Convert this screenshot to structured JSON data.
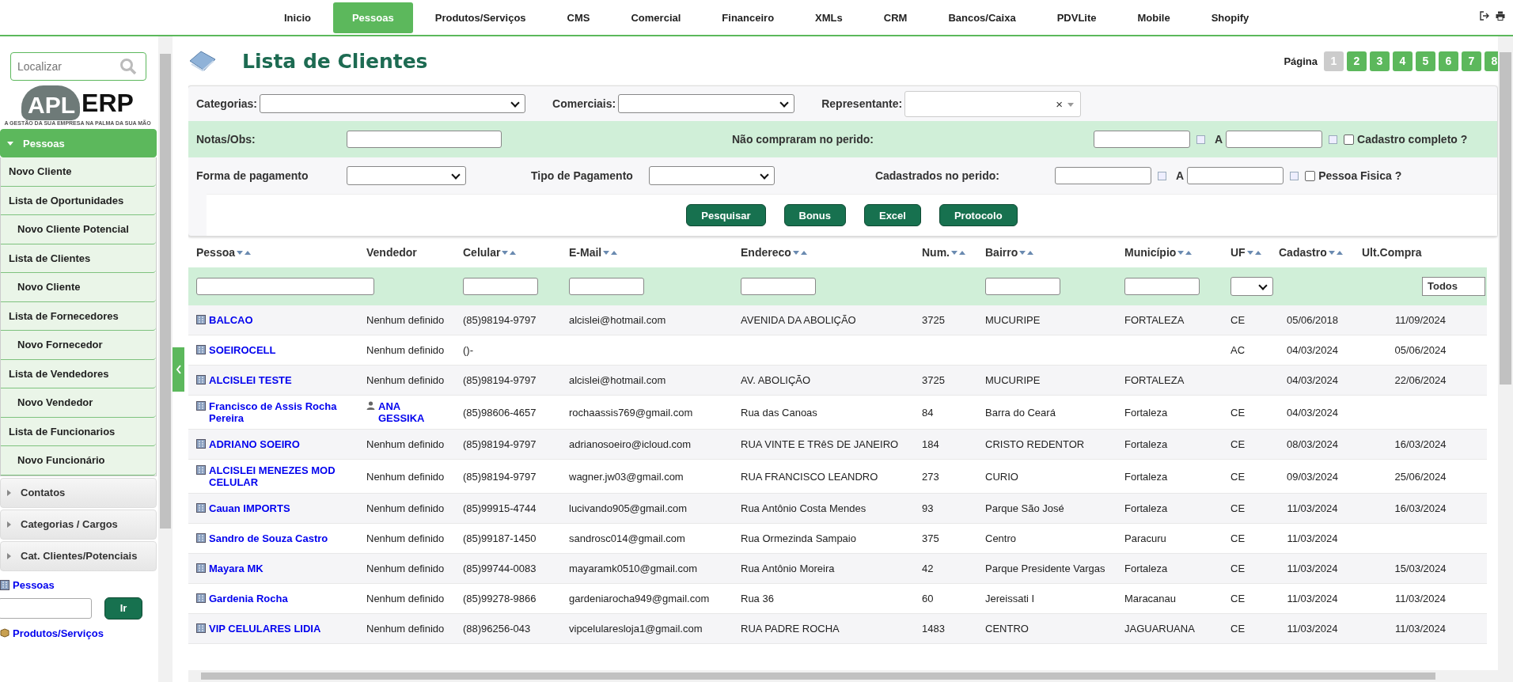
{
  "nav": {
    "items": [
      {
        "label": "Inicio",
        "selected": false
      },
      {
        "label": "Pessoas",
        "selected": true
      },
      {
        "label": "Produtos/Serviços",
        "selected": false
      },
      {
        "label": "CMS",
        "selected": false
      },
      {
        "label": "Comercial",
        "selected": false
      },
      {
        "label": "Financeiro",
        "selected": false
      },
      {
        "label": "XMLs",
        "selected": false
      },
      {
        "label": "CRM",
        "selected": false
      },
      {
        "label": "Bancos/Caixa",
        "selected": false
      },
      {
        "label": "PDVLite",
        "selected": false
      },
      {
        "label": "Mobile",
        "selected": false
      },
      {
        "label": "Shopify",
        "selected": false
      }
    ]
  },
  "sidebar": {
    "search_placeholder": "Localizar",
    "logo": {
      "left": "APL",
      "right": "ERP",
      "tagline": "A GESTÃO DA SUA EMPRESA NA PALMA DA SUA MÃO"
    },
    "sections": [
      {
        "label": "Pessoas",
        "expanded": true,
        "items": [
          {
            "label": "Novo Cliente"
          },
          {
            "label": "Lista de Oportunidades",
            "children": [
              {
                "label": "Novo Cliente Potencial"
              }
            ]
          },
          {
            "label": "Lista de Clientes",
            "children": [
              {
                "label": "Novo Cliente"
              }
            ]
          },
          {
            "label": "Lista de Fornecedores",
            "children": [
              {
                "label": "Novo Fornecedor"
              }
            ]
          },
          {
            "label": "Lista de Vendedores",
            "children": [
              {
                "label": "Novo Vendedor"
              }
            ]
          },
          {
            "label": "Lista de Funcionarios",
            "children": [
              {
                "label": "Novo Funcionário"
              }
            ]
          }
        ]
      },
      {
        "label": "Contatos",
        "expanded": false
      },
      {
        "label": "Categorias / Cargos",
        "expanded": false
      },
      {
        "label": "Cat. Clientes/Potenciais",
        "expanded": false
      }
    ],
    "quick_link": "Pessoas",
    "go_button": "Ir",
    "bottom_link": "Produtos/Serviços"
  },
  "page": {
    "title": "Lista de Clientes",
    "pagination_label": "Página",
    "pages": [
      {
        "label": "1",
        "selected": true
      },
      {
        "label": "2",
        "selected": false
      },
      {
        "label": "3",
        "selected": false
      },
      {
        "label": "4",
        "selected": false
      },
      {
        "label": "5",
        "selected": false
      },
      {
        "label": "6",
        "selected": false
      },
      {
        "label": "7",
        "selected": false
      },
      {
        "label": "8",
        "selected": false
      }
    ]
  },
  "filters": {
    "categorias": "Categorias:",
    "comerciais": "Comerciais:",
    "representante": "Representante:",
    "clear": "×",
    "notas": "Notas/Obs:",
    "nao_compraram": "Não compraram no perido:",
    "range_sep_1": "A",
    "cadastro_completo": {
      "label": "Cadastro completo ?",
      "checked": false
    },
    "forma_pagamento": "Forma de pagamento",
    "tipo_pagamento": "Tipo de Pagamento",
    "cadastrados": "Cadastrados no perido:",
    "range_sep_2": "A",
    "pessoa_fisica": {
      "label": "Pessoa Fisica ?",
      "checked": false
    },
    "buttons": [
      "Pesquisar",
      "Bonus",
      "Excel",
      "Protocolo"
    ]
  },
  "table": {
    "columns": [
      {
        "label": "Pessoa",
        "sortable": true,
        "kind": "text"
      },
      {
        "label": "Vendedor",
        "sortable": false,
        "kind": "none"
      },
      {
        "label": "Celular",
        "sortable": true,
        "kind": "text"
      },
      {
        "label": "E-Mail",
        "sortable": true,
        "kind": "text"
      },
      {
        "label": "Endereco",
        "sortable": true,
        "kind": "text"
      },
      {
        "label": "Num.",
        "sortable": true,
        "kind": "none"
      },
      {
        "label": "Bairro",
        "sortable": true,
        "kind": "text"
      },
      {
        "label": "Município",
        "sortable": true,
        "kind": "text"
      },
      {
        "label": "UF",
        "sortable": true,
        "kind": "select"
      },
      {
        "label": "Cadastro",
        "sortable": true,
        "kind": "none"
      },
      {
        "label": "Ult.Compra",
        "sortable": false,
        "kind": "none"
      }
    ],
    "status_filter": "Todos",
    "rows": [
      {
        "name": "BALCAO",
        "seller": {
          "kind": "plain",
          "name": "Nenhum definido"
        },
        "phone": "(85)98194-9797",
        "email": "alcislei@hotmail.com",
        "address": "AVENIDA DA ABOLIÇÃO",
        "number": "3725",
        "district": "MUCURIPE",
        "city": "FORTALEZA",
        "uf": "CE",
        "created": "05/06/2018",
        "last_purchase": "11/09/2024"
      },
      {
        "name": "SOEIROCELL",
        "seller": {
          "kind": "plain",
          "name": "Nenhum definido"
        },
        "phone": "()-",
        "uf": "AC",
        "created": "04/03/2024",
        "last_purchase": "05/06/2024"
      },
      {
        "name": "ALCISLEI TESTE",
        "seller": {
          "kind": "plain",
          "name": "Nenhum definido"
        },
        "phone": "(85)98194-9797",
        "email": "alcislei@hotmail.com",
        "address": "AV. ABOLIÇÃO",
        "number": "3725",
        "district": "MUCURIPE",
        "city": "FORTALEZA",
        "created": "04/03/2024",
        "last_purchase": "22/06/2024"
      },
      {
        "name": "Francisco de Assis Rocha Pereira",
        "seller": {
          "kind": "user",
          "name": "ANA GESSIKA"
        },
        "phone": "(85)98606-4657",
        "email": "rochaassis769@gmail.com",
        "address": "Rua das Canoas",
        "number": "84",
        "district": "Barra do Ceará",
        "city": "Fortaleza",
        "uf": "CE",
        "created": "04/03/2024"
      },
      {
        "name": "ADRIANO SOEIRO",
        "seller": {
          "kind": "plain",
          "name": "Nenhum definido"
        },
        "phone": "(85)98194-9797",
        "email": "adrianosoeiro@icloud.com",
        "address": "RUA VINTE E TRêS DE JANEIRO",
        "number": "184",
        "district": "CRISTO REDENTOR",
        "city": "Fortaleza",
        "uf": "CE",
        "created": "08/03/2024",
        "last_purchase": "16/03/2024"
      },
      {
        "name": "ALCISLEI MENEZES MOD CELULAR",
        "seller": {
          "kind": "plain",
          "name": "Nenhum definido"
        },
        "phone": "(85)98194-9797",
        "email": "wagner.jw03@gmail.com",
        "address": "RUA FRANCISCO LEANDRO",
        "number": "273",
        "district": "CURIO",
        "city": "Fortaleza",
        "uf": "CE",
        "created": "09/03/2024",
        "last_purchase": "25/06/2024"
      },
      {
        "name": "Cauan IMPORTS",
        "seller": {
          "kind": "plain",
          "name": "Nenhum definido"
        },
        "phone": "(85)99915-4744",
        "email": "lucivando905@gmail.com",
        "address": "Rua Antônio Costa Mendes",
        "number": "93",
        "district": "Parque São José",
        "city": "Fortaleza",
        "uf": "CE",
        "created": "11/03/2024",
        "last_purchase": "16/03/2024"
      },
      {
        "name": "Sandro de Souza Castro",
        "seller": {
          "kind": "plain",
          "name": "Nenhum definido"
        },
        "phone": "(85)99187-1450",
        "email": "sandrosc014@gmail.com",
        "address": "Rua Ormezinda Sampaio",
        "number": "375",
        "district": "Centro",
        "city": "Paracuru",
        "uf": "CE",
        "created": "11/03/2024"
      },
      {
        "name": "Mayara MK",
        "seller": {
          "kind": "plain",
          "name": "Nenhum definido"
        },
        "phone": "(85)99744-0083",
        "email": "mayaramk0510@gmail.com",
        "address": "Rua Antônio Moreira",
        "number": "42",
        "district": "Parque Presidente Vargas",
        "city": "Fortaleza",
        "uf": "CE",
        "created": "11/03/2024",
        "last_purchase": "15/03/2024"
      },
      {
        "name": "Gardenia Rocha",
        "seller": {
          "kind": "plain",
          "name": "Nenhum definido"
        },
        "phone": "(85)99278-9866",
        "email": "gardeniarocha949@gmail.com",
        "address": "Rua 36",
        "number": "60",
        "district": "Jereissati I",
        "city": "Maracanau",
        "uf": "CE",
        "created": "11/03/2024",
        "last_purchase": "11/03/2024"
      },
      {
        "name": "VIP CELULARES LIDIA",
        "seller": {
          "kind": "plain",
          "name": "Nenhum definido"
        },
        "phone": "(88)96256-043",
        "email": "vipcelularesloja1@gmail.com",
        "address": "RUA PADRE ROCHA",
        "number": "1483",
        "district": "CENTRO",
        "city": "JAGUARUANA",
        "uf": "CE",
        "created": "11/03/2024",
        "last_purchase": "11/03/2024"
      }
    ]
  }
}
